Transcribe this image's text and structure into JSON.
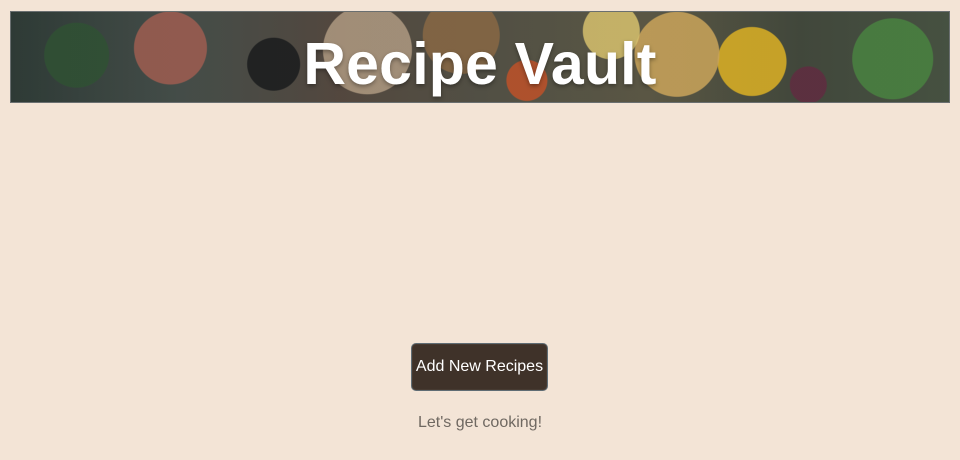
{
  "header": {
    "title": "Recipe Vault"
  },
  "main": {
    "add_button_label": "Add New Recipes",
    "tagline": "Let's get cooking!"
  },
  "colors": {
    "background": "#f3e4d6",
    "button": "#3f3229",
    "title_text": "#ffffff",
    "tagline_text": "#6f6861"
  }
}
